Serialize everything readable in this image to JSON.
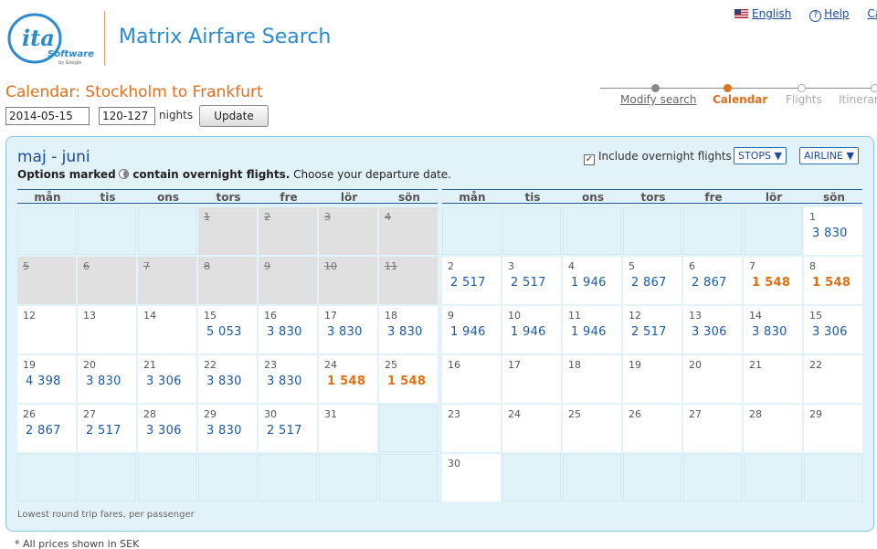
{
  "header": {
    "app_title": "Matrix Airfare Search",
    "logo_word": "ita",
    "logo_sub": "Software",
    "logo_by": "by Google",
    "links": {
      "language": "English",
      "help": "Help",
      "cart": "Ca"
    }
  },
  "steps": [
    {
      "label": "Modify search",
      "state": "done"
    },
    {
      "label": "Calendar",
      "state": "current"
    },
    {
      "label": "Flights",
      "state": "todo"
    },
    {
      "label": "Itinerar",
      "state": "todo"
    }
  ],
  "page_heading": "Calendar: Stockholm to Frankfurt",
  "form": {
    "date": "2014-05-15",
    "nights": "120-127",
    "nights_label": "nights",
    "update_label": "Update"
  },
  "calendar": {
    "month_title": "maj - juni",
    "notice_bold_1": "Options marked",
    "notice_bold_2": "contain overnight flights.",
    "notice_rest": "Choose your departure date.",
    "overnight_label": "Include overnight flights",
    "overnight_checked": true,
    "stops_label": "STOPS",
    "airline_label": "AIRLINE",
    "weekdays": [
      "mån",
      "tis",
      "ons",
      "tors",
      "fre",
      "lör",
      "sön"
    ],
    "months": [
      {
        "name": "maj",
        "weeks": [
          [
            null,
            null,
            null,
            {
              "d": "1",
              "past": true
            },
            {
              "d": "2",
              "past": true
            },
            {
              "d": "3",
              "past": true
            },
            {
              "d": "4",
              "past": true
            }
          ],
          [
            {
              "d": "5",
              "past": true
            },
            {
              "d": "6",
              "past": true
            },
            {
              "d": "7",
              "past": true
            },
            {
              "d": "8",
              "past": true
            },
            {
              "d": "9",
              "past": true
            },
            {
              "d": "10",
              "past": true
            },
            {
              "d": "11",
              "past": true
            }
          ],
          [
            {
              "d": "12"
            },
            {
              "d": "13"
            },
            {
              "d": "14"
            },
            {
              "d": "15",
              "p": "5 053"
            },
            {
              "d": "16",
              "p": "3 830"
            },
            {
              "d": "17",
              "p": "3 830"
            },
            {
              "d": "18",
              "p": "3 830"
            }
          ],
          [
            {
              "d": "19",
              "p": "4 398"
            },
            {
              "d": "20",
              "p": "3 830"
            },
            {
              "d": "21",
              "p": "3 306"
            },
            {
              "d": "22",
              "p": "3 830"
            },
            {
              "d": "23",
              "p": "3 830"
            },
            {
              "d": "24",
              "p": "1 548",
              "low": true
            },
            {
              "d": "25",
              "p": "1 548",
              "low": true
            }
          ],
          [
            {
              "d": "26",
              "p": "2 867"
            },
            {
              "d": "27",
              "p": "2 517"
            },
            {
              "d": "28",
              "p": "3 306"
            },
            {
              "d": "29",
              "p": "3 830"
            },
            {
              "d": "30",
              "p": "2 517"
            },
            {
              "d": "31"
            },
            null
          ],
          [
            null,
            null,
            null,
            null,
            null,
            null,
            null
          ]
        ]
      },
      {
        "name": "juni",
        "weeks": [
          [
            null,
            null,
            null,
            null,
            null,
            null,
            {
              "d": "1",
              "p": "3 830"
            }
          ],
          [
            {
              "d": "2",
              "p": "2 517"
            },
            {
              "d": "3",
              "p": "2 517"
            },
            {
              "d": "4",
              "p": "1 946"
            },
            {
              "d": "5",
              "p": "2 867"
            },
            {
              "d": "6",
              "p": "2 867"
            },
            {
              "d": "7",
              "p": "1 548",
              "low": true
            },
            {
              "d": "8",
              "p": "1 548",
              "low": true
            }
          ],
          [
            {
              "d": "9",
              "p": "1 946"
            },
            {
              "d": "10",
              "p": "1 946"
            },
            {
              "d": "11",
              "p": "1 946"
            },
            {
              "d": "12",
              "p": "2 517"
            },
            {
              "d": "13",
              "p": "3 306"
            },
            {
              "d": "14",
              "p": "3 830"
            },
            {
              "d": "15",
              "p": "3 306"
            }
          ],
          [
            {
              "d": "16"
            },
            {
              "d": "17"
            },
            {
              "d": "18"
            },
            {
              "d": "19"
            },
            {
              "d": "20"
            },
            {
              "d": "21"
            },
            {
              "d": "22"
            }
          ],
          [
            {
              "d": "23"
            },
            {
              "d": "24"
            },
            {
              "d": "25"
            },
            {
              "d": "26"
            },
            {
              "d": "27"
            },
            {
              "d": "28"
            },
            {
              "d": "29"
            }
          ],
          [
            {
              "d": "30"
            },
            null,
            null,
            null,
            null,
            null,
            null
          ]
        ]
      }
    ],
    "footnote": "Lowest round trip fares, per passenger"
  },
  "prices_note": "* All prices shown in SEK",
  "colors": {
    "accent_orange": "#e0701e",
    "link_blue": "#1a4ba0",
    "price_blue": "#1a5aa8",
    "panel_bg": "#e2f2f9"
  }
}
